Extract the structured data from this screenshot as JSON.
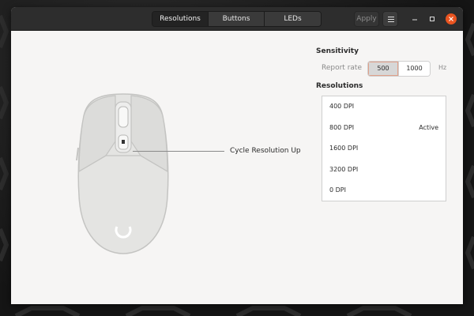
{
  "window": {
    "tabs": [
      {
        "label": "Resolutions",
        "active": true
      },
      {
        "label": "Buttons",
        "active": false
      },
      {
        "label": "LEDs",
        "active": false
      }
    ],
    "apply_label": "Apply",
    "menu_icon": "hamburger-menu-icon",
    "minimize_icon": "minimize-icon",
    "maximize_icon": "maximize-icon",
    "close_icon": "close-icon"
  },
  "device": {
    "callout_label": "Cycle Resolution Up",
    "logo_icon": "logo-ring-icon"
  },
  "sensitivity": {
    "title": "Sensitivity",
    "report_rate_label": "Report rate",
    "rates": [
      {
        "label": "500",
        "selected": true
      },
      {
        "label": "1000",
        "selected": false
      }
    ],
    "unit": "Hz"
  },
  "resolutions": {
    "title": "Resolutions",
    "items": [
      {
        "label": "400 DPI",
        "status": ""
      },
      {
        "label": "800 DPI",
        "status": "Active"
      },
      {
        "label": "1600 DPI",
        "status": ""
      },
      {
        "label": "3200 DPI",
        "status": ""
      },
      {
        "label": "0 DPI",
        "status": ""
      }
    ]
  },
  "colors": {
    "accent": "#e95420",
    "headerbar": "#2d2d2d",
    "window_bg": "#f6f5f4"
  }
}
